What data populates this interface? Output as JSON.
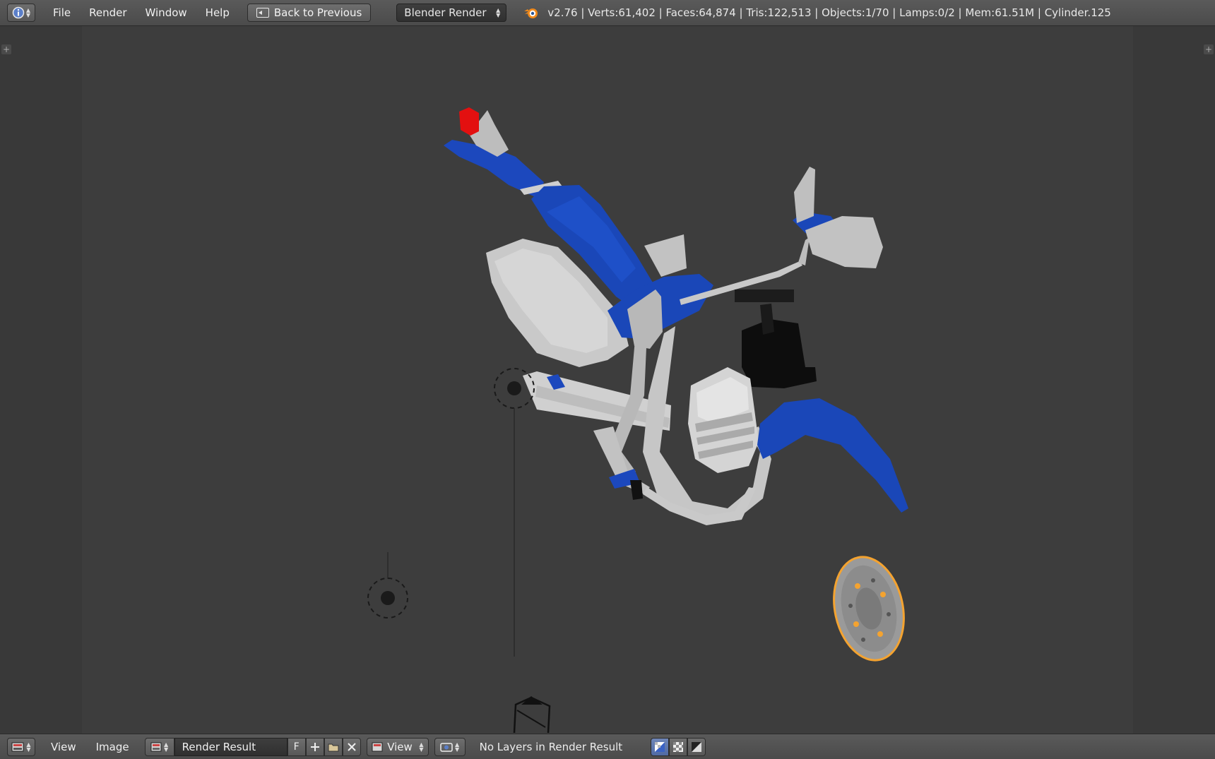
{
  "header": {
    "menus": [
      "File",
      "Render",
      "Window",
      "Help"
    ],
    "back_button": "Back to Previous",
    "render_engine": "Blender Render",
    "stats": "v2.76 | Verts:61,402 | Faces:64,874 | Tris:122,513 | Objects:1/70 | Lamps:0/2 | Mem:61.51M | Cylinder.125"
  },
  "image_editor": {
    "menus": [
      "View",
      "Image"
    ],
    "image_name": "Render Result",
    "fake_user": "F",
    "slot": "View",
    "status": "No Layers in Render Result"
  },
  "icons": {
    "editor_type": "info-icon",
    "engine_logo": "blender-logo-icon",
    "image_browse": "image-browse-icon",
    "new_image": "plus-icon",
    "open_image": "folder-icon",
    "unlink_image": "close-icon",
    "display_channels": [
      "color-alpha-icon",
      "alpha-checker-icon",
      "z-buffer-icon"
    ]
  },
  "colors": {
    "header_bg": "#4f4f4f",
    "viewport_bg": "#3d3d3d",
    "bike_blue": "#1b46b8",
    "selection_outline": "#f4a330",
    "tail_light": "#e31010"
  }
}
